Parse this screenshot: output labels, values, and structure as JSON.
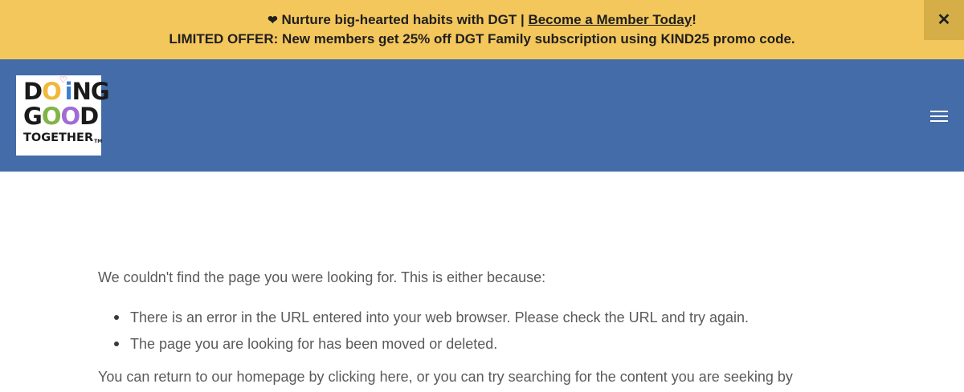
{
  "announcement": {
    "line1_prefix": "Nurture big-hearted habits with DGT |",
    "line1_link": "Become a Member Today",
    "line1_suffix": "!",
    "line2_prefix": "LIMITED OFFER: New members get 25% off DGT Family subscription using",
    "line2_code": "KIND25",
    "line2_suffix": "promo code.",
    "close_icon": "close-icon"
  },
  "header": {
    "logo": {
      "row1": [
        "D",
        "O",
        "i",
        "NG"
      ],
      "row2": [
        "G",
        "O",
        "O",
        "D"
      ],
      "row3": "TOGETHER",
      "tm": "TM"
    },
    "menu_icon": "hamburger-icon",
    "background": "#436ca8"
  },
  "main": {
    "intro": "We couldn't find the page you were looking for. This is either because:",
    "reasons": [
      "There is an error in the URL entered into your web browser. Please check the URL and try again.",
      "The page you are looking for has been moved or deleted."
    ],
    "tail_prefix": "You can return to our homepage by clicking",
    "tail_link": "here",
    "tail_suffix": ", or you can try searching for the content you are seeking by"
  },
  "colors": {
    "announcement_bg": "#f4c75c",
    "header_bg": "#436ca8",
    "body_text": "#5a5a5a"
  }
}
